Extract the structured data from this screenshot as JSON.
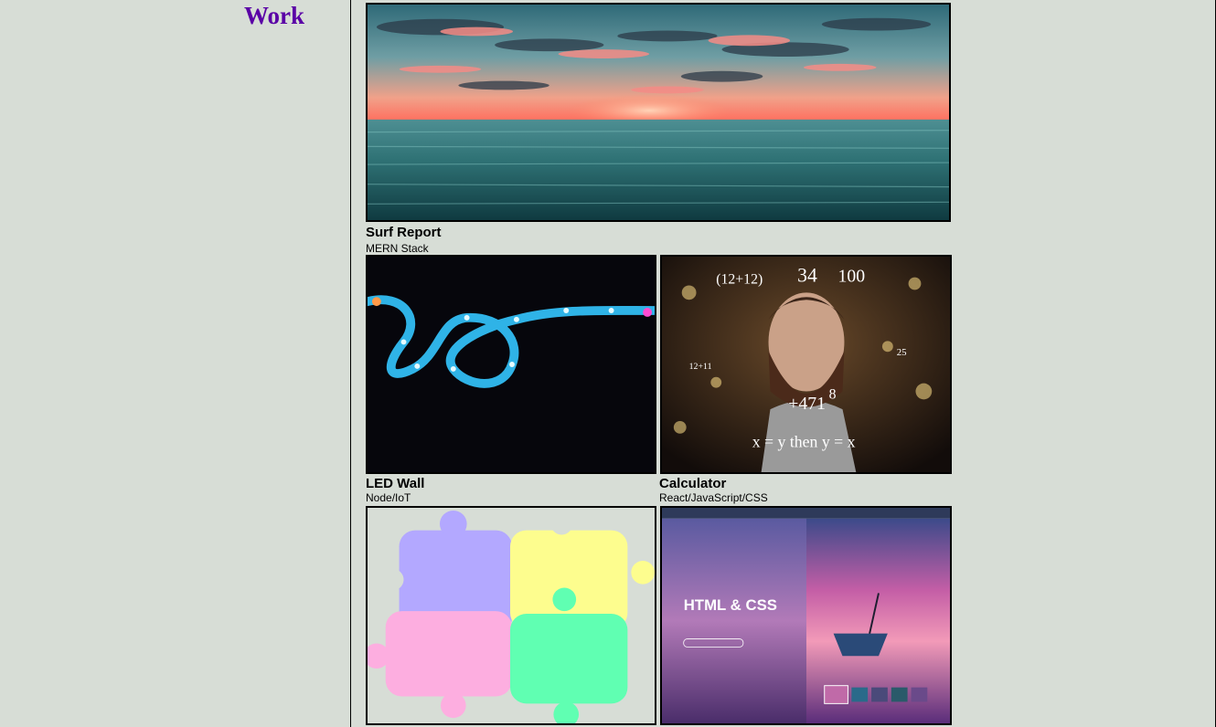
{
  "sidebar": {
    "title": "Work"
  },
  "projects": [
    {
      "title": "Surf Report",
      "stack": "MERN Stack",
      "image": "ocean-sunset-image"
    },
    {
      "title": "LED Wall",
      "stack": "Node/IoT",
      "image": "led-strip-image"
    },
    {
      "title": "Calculator",
      "stack": "React/JavaScript/CSS",
      "image": "math-meme-image"
    },
    {
      "title": "",
      "stack": "",
      "image": "puzzle-pieces-image"
    },
    {
      "title": "",
      "stack": "",
      "image": "html-css-site-image"
    }
  ],
  "thumb_text": {
    "calculator_overlay": [
      "(12+12)",
      "34",
      "100",
      "25",
      "12+11",
      "+471",
      "8",
      "x = y then y = x"
    ],
    "site_heading": "HTML & CSS"
  },
  "colors": {
    "background": "#d7ddd6",
    "accent": "#5a00a6",
    "puzzle_purple": "#b3a8ff",
    "puzzle_yellow": "#fdfd8e",
    "puzzle_pink": "#fdaee0",
    "puzzle_green": "#60ffb2"
  }
}
